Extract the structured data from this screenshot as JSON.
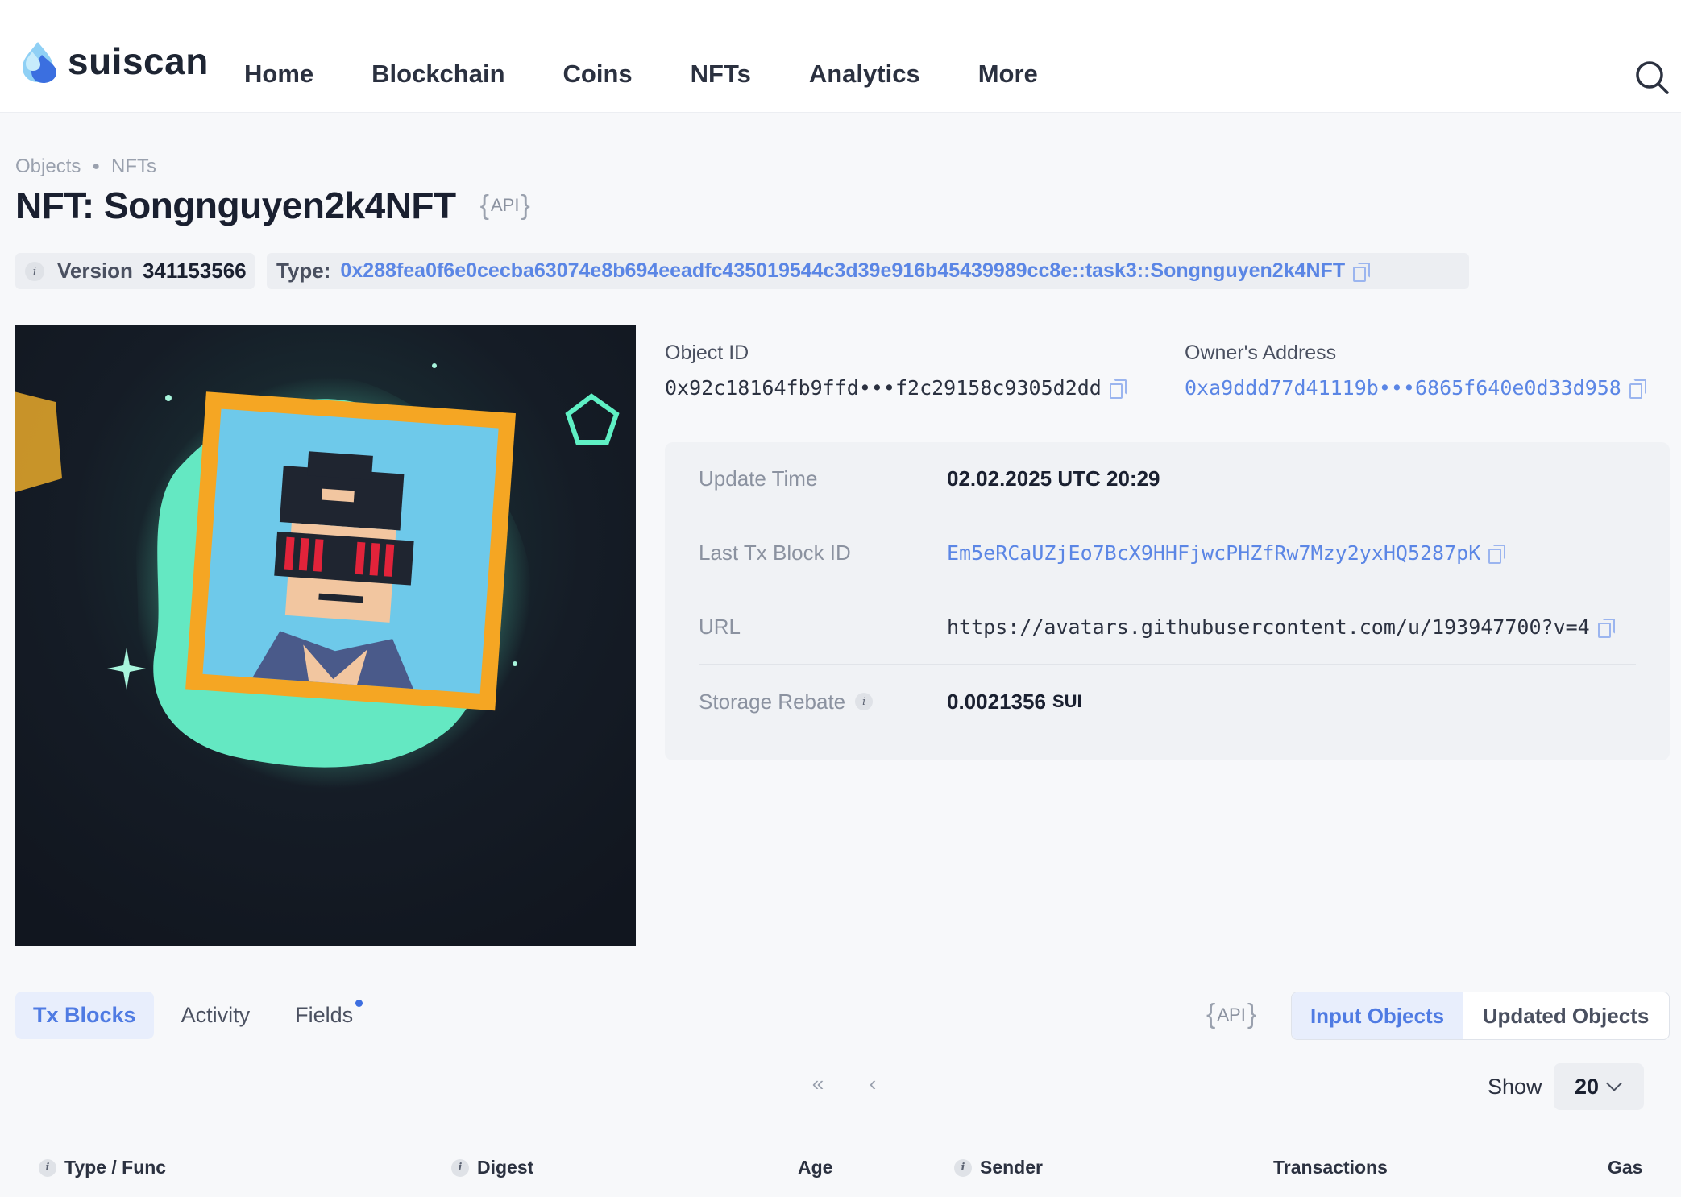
{
  "app": {
    "name": "suiscan"
  },
  "nav": {
    "items": [
      "Home",
      "Blockchain",
      "Coins",
      "NFTs",
      "Analytics",
      "More"
    ]
  },
  "breadcrumb": {
    "items": [
      "Objects",
      "NFTs"
    ]
  },
  "page": {
    "title": "NFT: Songnguyen2k4NFT",
    "api_label": "API"
  },
  "version": {
    "label": "Version",
    "value": "341153566"
  },
  "type": {
    "label": "Type:",
    "value": "0x288fea0f6e0cecba63074e8b694eeadfc435019544c3d39e916b45439989cc8e::task3::Songnguyen2k4NFT"
  },
  "object": {
    "id_label": "Object ID",
    "id_value": "0x92c18164fb9ffd•••f2c29158c9305d2dd",
    "owner_label": "Owner's Address",
    "owner_value": "0xa9ddd77d41119b•••6865f640e0d33d958"
  },
  "details": {
    "update_time_label": "Update Time",
    "update_time_value": "02.02.2025 UTC 20:29",
    "last_tx_label": "Last Tx Block ID",
    "last_tx_value": "Em5eRCaUZjEo7BcX9HHFjwcPHZfRw7Mzy2yxHQ5287pK",
    "url_label": "URL",
    "url_value": "https://avatars.githubusercontent.com/u/193947700?v=4",
    "storage_label": "Storage Rebate",
    "storage_value": "0.0021356",
    "storage_unit": "SUI"
  },
  "tabs": {
    "items": [
      "Tx Blocks",
      "Activity",
      "Fields"
    ],
    "active": "Tx Blocks",
    "api_label": "API"
  },
  "toggle": {
    "on": "Input Objects",
    "off": "Updated Objects"
  },
  "pagination": {
    "show_label": "Show",
    "page_size": "20"
  },
  "table": {
    "columns": [
      "Type / Func",
      "Digest",
      "Age",
      "Sender",
      "Transactions",
      "Gas"
    ]
  },
  "colors": {
    "accent": "#4f7be3",
    "link": "#5b86e5",
    "background": "#f7f8fa"
  }
}
